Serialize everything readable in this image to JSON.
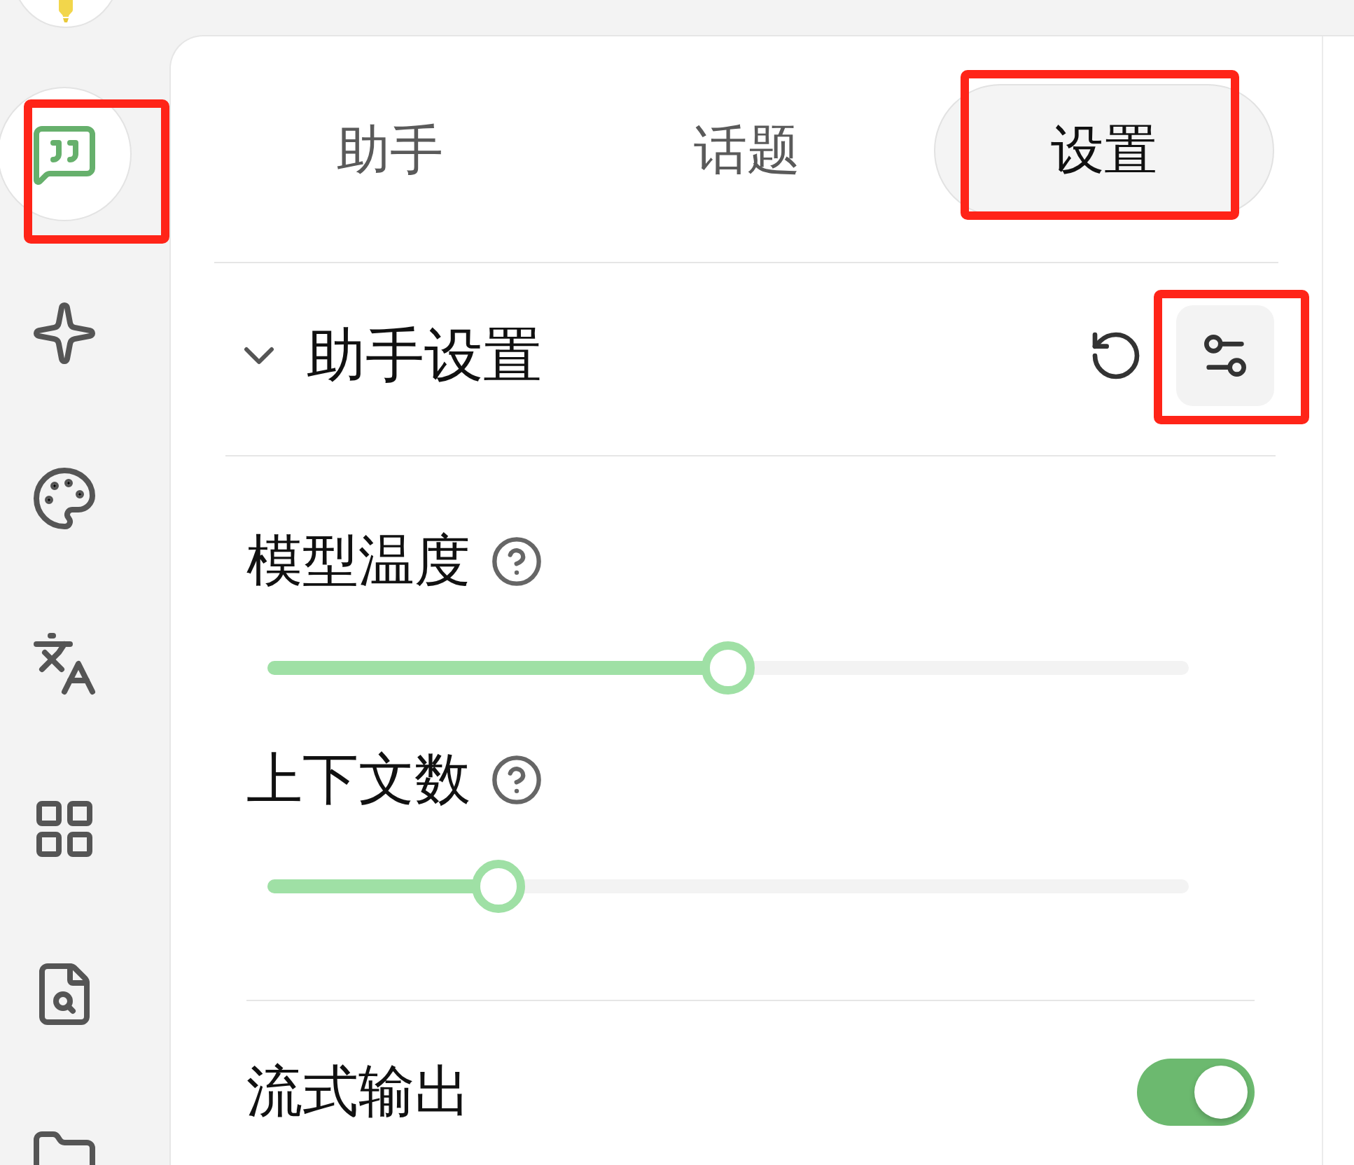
{
  "sidebar": {
    "items": [
      {
        "selected": true,
        "highlighted": true
      },
      {
        "selected": false,
        "highlighted": false
      },
      {
        "selected": false,
        "highlighted": false
      },
      {
        "selected": false,
        "highlighted": false
      },
      {
        "selected": false,
        "highlighted": false
      },
      {
        "selected": false,
        "highlighted": false
      },
      {
        "selected": false,
        "highlighted": false
      }
    ]
  },
  "tabs": [
    {
      "label": "助手",
      "selected": false,
      "highlighted": false
    },
    {
      "label": "话题",
      "selected": false,
      "highlighted": false
    },
    {
      "label": "设置",
      "selected": true,
      "highlighted": true
    }
  ],
  "section": {
    "title": "助手设置",
    "expanded": true,
    "actions": [
      {
        "active": false,
        "highlighted": false
      },
      {
        "active": true,
        "highlighted": true
      }
    ],
    "settings": [
      {
        "kind": "slider",
        "label": "模型温度",
        "help": true,
        "level": 0.5
      },
      {
        "kind": "slider",
        "label": "上下文数",
        "help": true,
        "level": 0.25
      },
      {
        "kind": "switch",
        "label": "流式输出",
        "on": true
      }
    ]
  }
}
